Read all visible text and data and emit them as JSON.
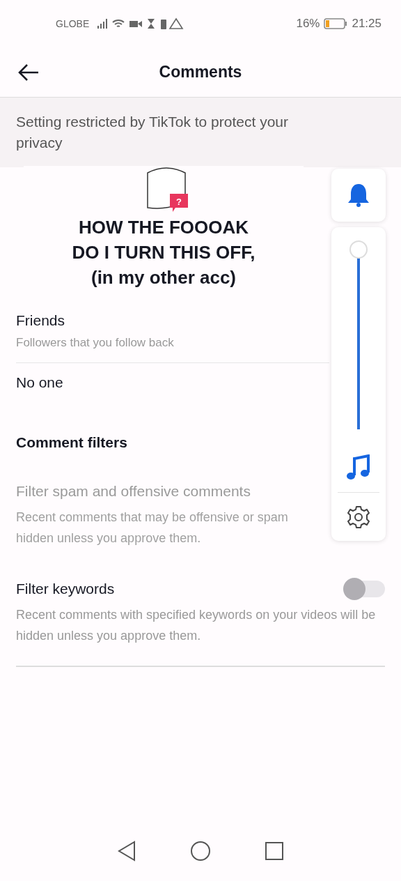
{
  "status_bar": {
    "carrier": "GLOBE",
    "battery_percent": "16%",
    "time": "21:25"
  },
  "header": {
    "title": "Comments"
  },
  "notice": {
    "text": "Setting restricted by TikTok to protect your privacy"
  },
  "settings": [
    {
      "kind": "option",
      "title": "Friends",
      "subtitle": "Followers that you follow back"
    },
    {
      "kind": "option",
      "title": "No one"
    },
    {
      "kind": "heading",
      "title": "Comment filters"
    },
    {
      "kind": "toggle",
      "title": "Filter spam and offensive comments",
      "subtitle": "Recent comments that may be offensive or spam",
      "subtitle_2": "hidden unless you approve them.",
      "disabled": true
    },
    {
      "kind": "toggle",
      "title": "Filter keywords",
      "subtitle": "Recent comments with specified keywords on your videos will be hidden unless you approve them.",
      "disabled": false,
      "on": false
    }
  ],
  "caption": {
    "lines": [
      "HOW THE FOOOAK",
      "DO I TURN THIS OFF,",
      "(in my other acc)"
    ],
    "badge": "?"
  },
  "volume_panel": {
    "level": 1
  }
}
